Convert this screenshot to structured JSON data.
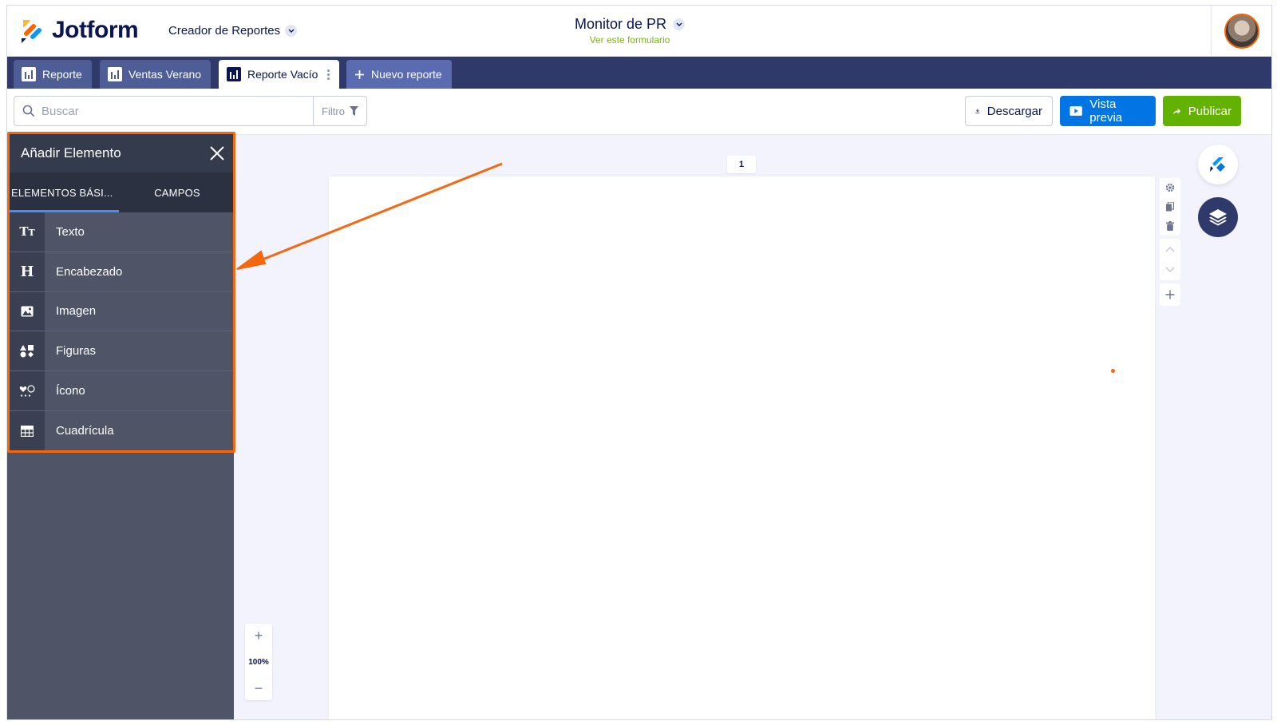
{
  "header": {
    "logo_text": "Jotform",
    "builder_label": "Creador de Reportes",
    "form_title": "Monitor de PR",
    "form_subtitle": "Ver este formulario"
  },
  "tabs": [
    {
      "label": "Reporte",
      "state": "inactive"
    },
    {
      "label": "Ventas Verano",
      "state": "inactive"
    },
    {
      "label": "Reporte Vacío",
      "state": "active"
    },
    {
      "label": "Nuevo reporte",
      "state": "new"
    }
  ],
  "toolbar": {
    "search_placeholder": "Buscar",
    "filter_label": "Filtro",
    "download_label": "Descargar",
    "preview_label": "Vista previa",
    "publish_label": "Publicar"
  },
  "panel": {
    "title": "Añadir Elemento",
    "tabs": [
      "ELEMENTOS BÁSI...",
      "CAMPOS"
    ],
    "items": [
      {
        "label": "Texto",
        "icon": "text-icon"
      },
      {
        "label": "Encabezado",
        "icon": "heading-icon"
      },
      {
        "label": "Imagen",
        "icon": "image-icon"
      },
      {
        "label": "Figuras",
        "icon": "shapes-icon"
      },
      {
        "label": "Ícono",
        "icon": "icon-icon"
      },
      {
        "label": "Cuadrícula",
        "icon": "grid-icon"
      }
    ]
  },
  "canvas": {
    "page_number": "1",
    "zoom_level": "100%"
  },
  "colors": {
    "highlight": "#f6680f",
    "tabs_bar": "#2f3a6b",
    "preview": "#0075e3",
    "publish": "#64b200",
    "sidebar": "#4f5567"
  }
}
